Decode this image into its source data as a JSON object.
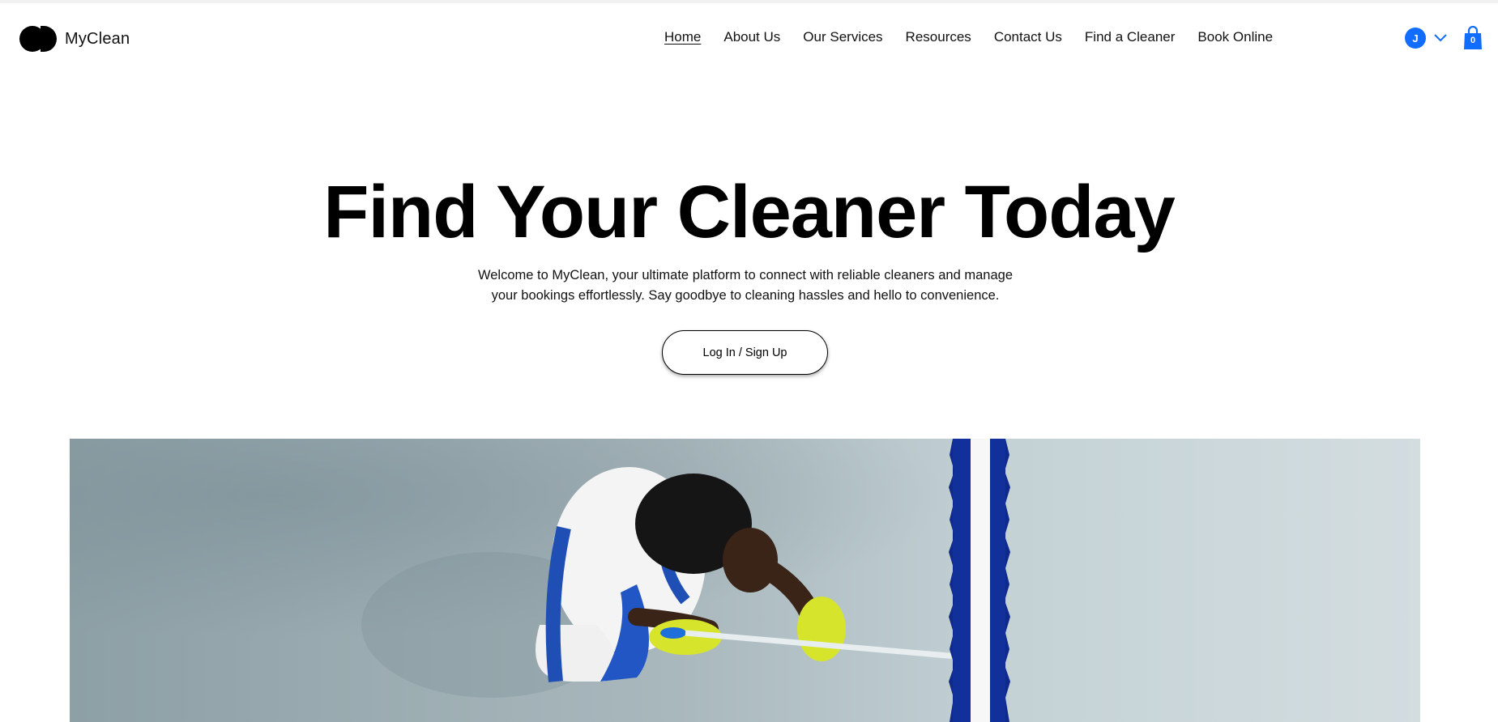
{
  "brand": {
    "name": "MyClean",
    "logo_icon": "two-dots-logo-icon"
  },
  "nav": {
    "items": [
      {
        "label": "Home",
        "active": true
      },
      {
        "label": "About Us",
        "active": false
      },
      {
        "label": "Our Services",
        "active": false
      },
      {
        "label": "Resources",
        "active": false
      },
      {
        "label": "Contact Us",
        "active": false
      },
      {
        "label": "Find a Cleaner",
        "active": false
      },
      {
        "label": "Book Online",
        "active": false
      }
    ]
  },
  "user": {
    "initial": "J",
    "avatar_color": "#116dff",
    "menu_icon": "chevron-down-icon"
  },
  "cart": {
    "count": "0",
    "icon": "shopping-bag-icon",
    "color": "#116dff"
  },
  "hero": {
    "title": "Find Your Cleaner Today",
    "description": "Welcome to MyClean, your ultimate platform to connect with reliable cleaners and manage your bookings effortlessly. Say goodbye to cleaning hassles and hello to convenience.",
    "cta_label": "Log In / Sign Up",
    "image_alt": "cleaner-mopping-floor-photo"
  }
}
